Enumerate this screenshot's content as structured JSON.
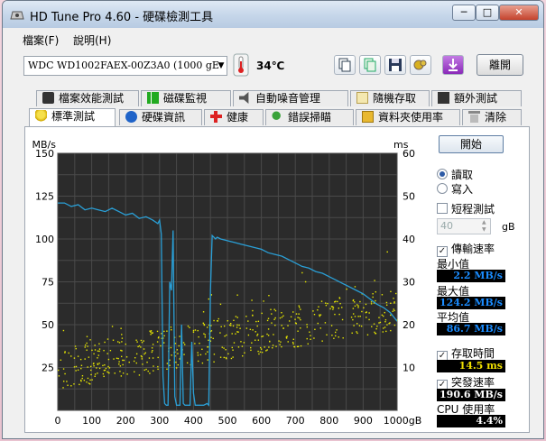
{
  "window": {
    "title": "HD Tune Pro 4.60 - 硬碟檢測工具",
    "min_glyph": "─",
    "max_glyph": "□",
    "close_glyph": "✕"
  },
  "menu": {
    "file": "檔案(F)",
    "help": "說明(H)"
  },
  "toolbar": {
    "drive": "WDC WD1002FAEX-00Z3A0  (1000 gE",
    "temperature": "34℃",
    "exit_label": "離開",
    "icons": [
      "copy-icon",
      "copy-info-icon",
      "save-icon",
      "options-icon",
      "download-icon"
    ]
  },
  "tabs_row1": [
    {
      "label": "檔案效能測試",
      "icon": "file-benchmark-icon"
    },
    {
      "label": "磁碟監視",
      "icon": "disk-monitor-icon"
    },
    {
      "label": "自動噪音管理",
      "icon": "speaker-icon"
    },
    {
      "label": "隨機存取",
      "icon": "random-access-icon"
    },
    {
      "label": "額外測試",
      "icon": "extra-tests-icon"
    }
  ],
  "tabs_row2": [
    {
      "label": "標準測試",
      "icon": "benchmark-icon",
      "active": true
    },
    {
      "label": "硬碟資訊",
      "icon": "info-icon"
    },
    {
      "label": "健康",
      "icon": "health-icon"
    },
    {
      "label": "錯誤掃瞄",
      "icon": "error-scan-icon"
    },
    {
      "label": "資料夾使用率",
      "icon": "folder-usage-icon"
    },
    {
      "label": "清除",
      "icon": "erase-icon"
    }
  ],
  "controls": {
    "start": "開始",
    "read": "讀取",
    "write": "寫入",
    "mode": "read",
    "short_test": "短程測試",
    "short_test_checked": false,
    "short_test_value": "40",
    "short_test_unit": "gB",
    "transfer_rate": "傳輸速率",
    "transfer_rate_checked": true,
    "access_time": "存取時間",
    "access_time_checked": true,
    "burst_rate": "突發速率",
    "burst_rate_checked": true
  },
  "results": {
    "min_label": "最小值",
    "min_value": "2.2 MB/s",
    "max_label": "最大值",
    "max_value": "124.2 MB/s",
    "avg_label": "平均值",
    "avg_value": "86.7 MB/s",
    "access_time_value": "14.5 ms",
    "burst_rate_value": "190.6 MB/s",
    "cpu_label": "CPU 使用率",
    "cpu_value": "4.4%"
  },
  "colors": {
    "transfer_line": "#2a9fd6",
    "access_points": "#e8e800",
    "plot_bg": "#2b2b2b",
    "grid": "#4a4a4a"
  },
  "chart_data": {
    "type": "line",
    "y_left_label": "MB/s",
    "y_right_label": "ms",
    "x_unit": "gB",
    "xlim": [
      0,
      1000
    ],
    "ylim": [
      0,
      150
    ],
    "y2lim": [
      0,
      60
    ],
    "x_ticks": [
      "0",
      "100",
      "200",
      "300",
      "400",
      "500",
      "600",
      "700",
      "800",
      "900",
      "1000gB"
    ],
    "y_ticks": [
      "25",
      "50",
      "75",
      "100",
      "125",
      "150"
    ],
    "y2_ticks": [
      "10",
      "20",
      "30",
      "40",
      "50",
      "60"
    ],
    "grid": true,
    "series": [
      {
        "kind": "transfer-rate",
        "x": [
          0,
          20,
          40,
          60,
          80,
          100,
          120,
          140,
          160,
          180,
          200,
          220,
          240,
          260,
          280,
          295,
          300,
          305,
          310,
          315,
          320,
          325,
          330,
          335,
          340,
          345,
          350,
          360,
          365,
          370,
          375,
          380,
          385,
          390,
          395,
          400,
          405,
          410,
          420,
          430,
          440,
          445,
          450,
          455,
          460,
          465,
          470,
          480,
          500,
          520,
          540,
          560,
          580,
          600,
          620,
          640,
          660,
          680,
          700,
          720,
          740,
          760,
          780,
          800,
          820,
          840,
          860,
          880,
          900,
          920,
          940,
          960,
          980,
          1000
        ],
        "y": [
          121,
          121,
          119,
          120,
          117,
          118,
          117,
          116,
          118,
          116,
          114,
          115,
          112,
          113,
          111,
          109,
          111,
          103,
          20,
          4,
          3,
          3,
          75,
          70,
          105,
          8,
          3,
          3,
          50,
          4,
          3,
          3,
          3,
          3,
          40,
          10,
          3,
          3,
          3,
          3,
          4,
          3,
          70,
          102,
          101,
          100,
          101,
          100,
          99,
          98,
          97,
          96,
          95,
          94,
          92,
          91,
          90,
          88,
          86,
          84,
          83,
          81,
          80,
          78,
          76,
          74,
          72,
          70,
          68,
          65,
          62,
          60,
          57,
          52
        ]
      },
      {
        "kind": "access-time",
        "trend_x": [
          0,
          1000
        ],
        "trend_y": [
          10,
          24
        ]
      }
    ]
  }
}
